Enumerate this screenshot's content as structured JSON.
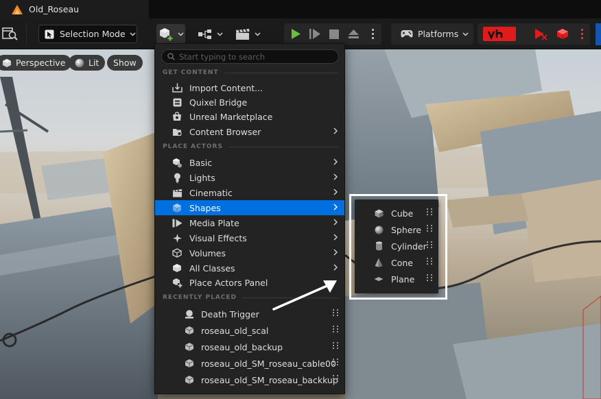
{
  "window": {
    "project_tab": "Old_Roseau"
  },
  "toolbar": {
    "mode_label": "Selection Mode",
    "platforms_label": "Platforms"
  },
  "viewport": {
    "perspective_label": "Perspective",
    "lit_label": "Lit",
    "show_label": "Show"
  },
  "add_menu": {
    "search_placeholder": "Start typing to search",
    "get_content": {
      "header": "GET CONTENT",
      "items": [
        {
          "label": "Import Content...",
          "icon": "import-icon",
          "submenu": false
        },
        {
          "label": "Quixel Bridge",
          "icon": "bridge-icon",
          "submenu": false
        },
        {
          "label": "Unreal Marketplace",
          "icon": "marketplace-icon",
          "submenu": false
        },
        {
          "label": "Content Browser",
          "icon": "content-browser-icon",
          "submenu": true
        }
      ]
    },
    "place_actors": {
      "header": "PLACE ACTORS",
      "items": [
        {
          "label": "Basic",
          "icon": "basic-icon",
          "submenu": true
        },
        {
          "label": "Lights",
          "icon": "light-bulb-icon",
          "submenu": true
        },
        {
          "label": "Cinematic",
          "icon": "clapperboard-icon",
          "submenu": true
        },
        {
          "label": "Shapes",
          "icon": "shapes-icon",
          "submenu": true,
          "selected": true
        },
        {
          "label": "Media Plate",
          "icon": "media-plate-icon",
          "submenu": true
        },
        {
          "label": "Visual Effects",
          "icon": "visual-effects-icon",
          "submenu": true
        },
        {
          "label": "Volumes",
          "icon": "volumes-icon",
          "submenu": true
        },
        {
          "label": "All Classes",
          "icon": "all-classes-icon",
          "submenu": true
        },
        {
          "label": "Place Actors Panel",
          "icon": "place-actors-icon",
          "submenu": false
        }
      ]
    },
    "recently_placed": {
      "header": "RECENTLY PLACED",
      "items": [
        {
          "label": "Death Trigger",
          "icon": "trigger-icon"
        },
        {
          "label": "roseau_old_scal",
          "icon": "static-mesh-icon"
        },
        {
          "label": "roseau_old_backup",
          "icon": "static-mesh-icon"
        },
        {
          "label": "roseau_old_SM_roseau_cable00",
          "icon": "static-mesh-icon"
        },
        {
          "label": "roseau_old_SM_roseau_backkup",
          "icon": "static-mesh-icon"
        }
      ]
    }
  },
  "shapes_submenu": {
    "items": [
      {
        "label": "Cube",
        "icon": "cube-icon"
      },
      {
        "label": "Sphere",
        "icon": "sphere-icon"
      },
      {
        "label": "Cylinder",
        "icon": "cylinder-icon"
      },
      {
        "label": "Cone",
        "icon": "cone-icon"
      },
      {
        "label": "Plane",
        "icon": "plane-icon"
      }
    ]
  },
  "colors": {
    "selection": "#0070e0",
    "menu_bg": "#232323",
    "play_green": "#6dbf3c",
    "accent_red": "#e01b1b"
  }
}
